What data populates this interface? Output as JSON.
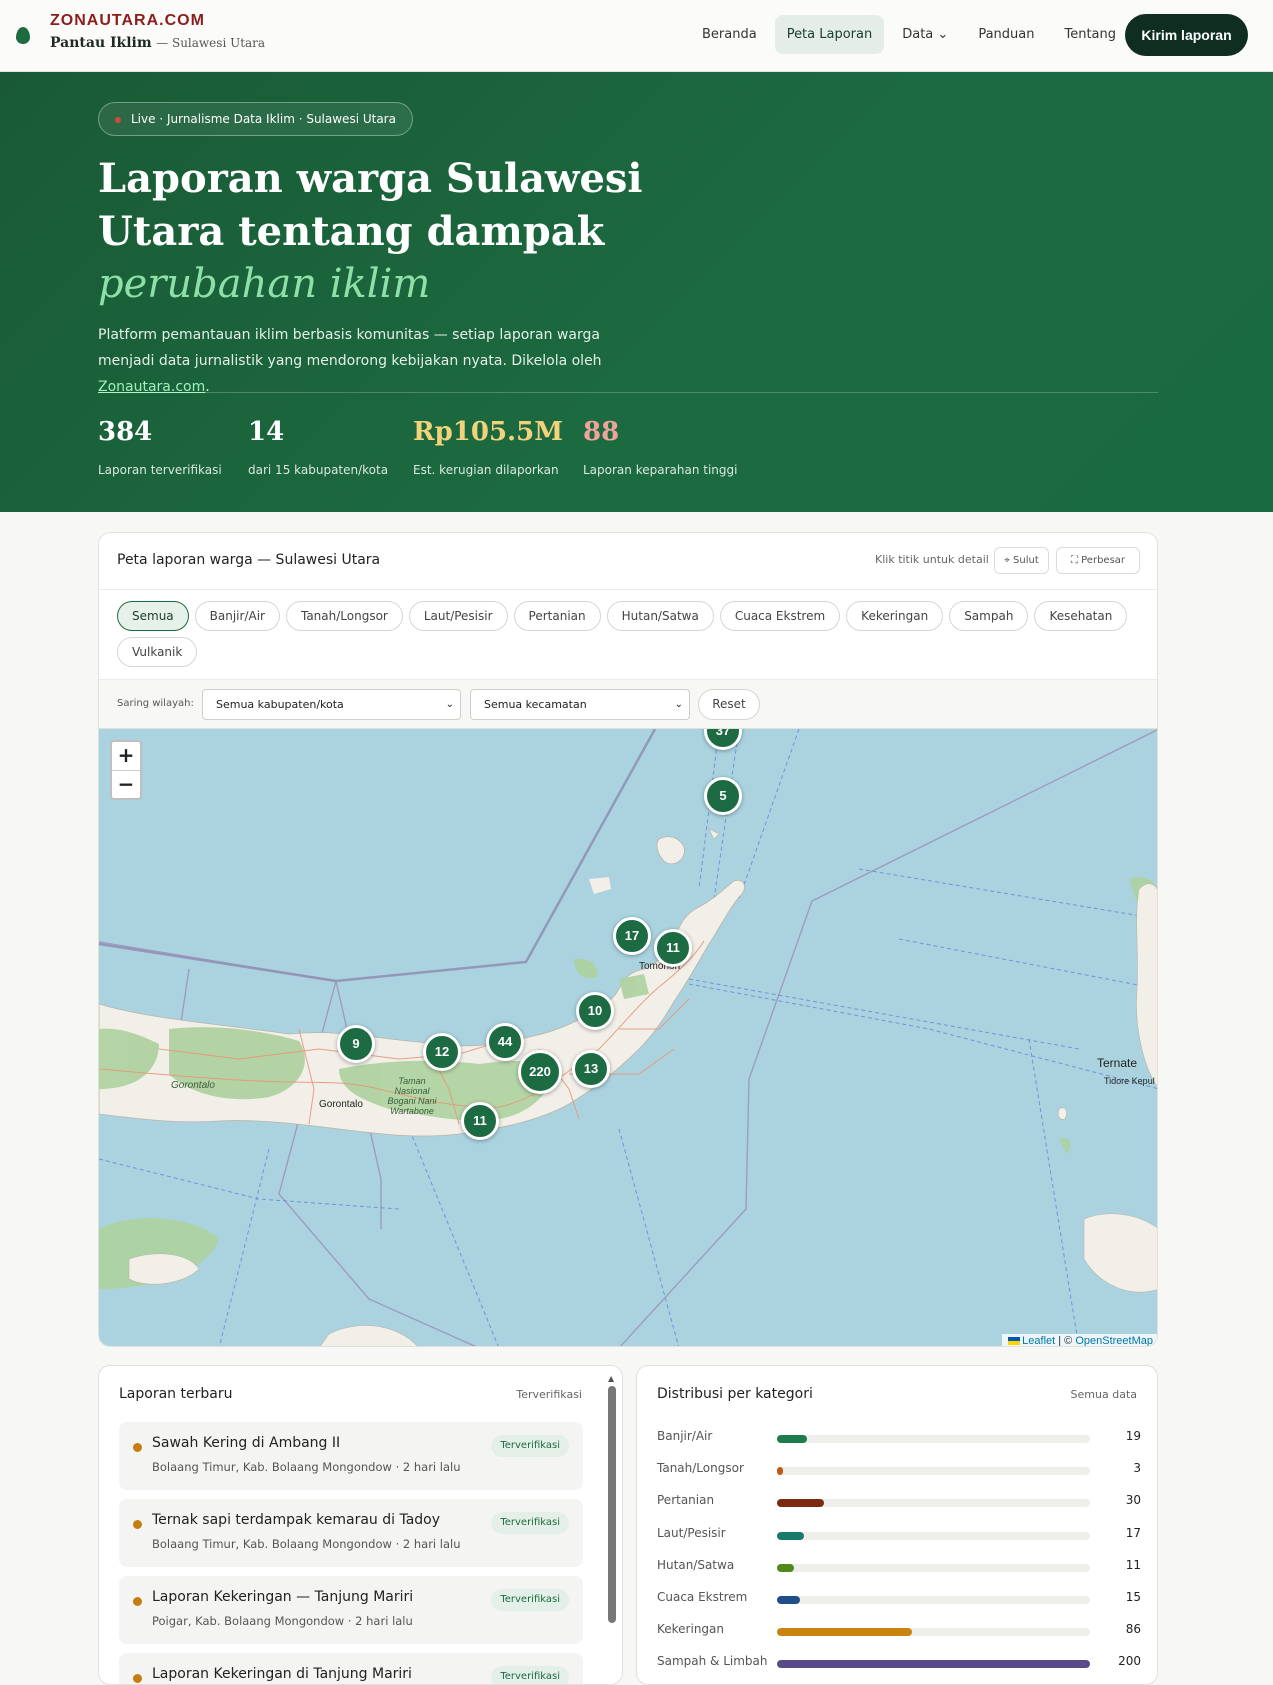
{
  "nav": {
    "brand_site": "ZONAUTARA.COM",
    "brand_title": "Pantau Iklim",
    "brand_region": "— Sulawesi Utara",
    "links": [
      "Beranda",
      "Peta Laporan",
      "Data ⌄",
      "Panduan",
      "Tentang"
    ],
    "active": "Peta Laporan",
    "cta": "Kirim laporan"
  },
  "hero": {
    "badge": "Live · Jurnalisme Data Iklim · Sulawesi Utara",
    "title_line": "Laporan warga Sulawesi Utara tentang dampak",
    "title_emph": "perubahan iklim",
    "lead": "Platform pemantauan iklim berbasis komunitas — setiap laporan warga menjadi data jurnalistik yang mendorong kebijakan nyata. Dikelola oleh",
    "lead_link": "Zonautara.com",
    "lead_end": ".",
    "stats": [
      {
        "value": "384",
        "label": "Laporan terverifikasi",
        "color": "#ffffff"
      },
      {
        "value": "14",
        "label": "dari 15 kabupaten/kota",
        "color": "#ffffff"
      },
      {
        "value": "Rp105.5M",
        "label": "Est. kerugian dilaporkan",
        "color": "#f2d27a"
      },
      {
        "value": "88",
        "label": "Laporan keparahan tinggi",
        "color": "#f0a39a"
      }
    ]
  },
  "map": {
    "title": "Peta laporan warga — Sulawesi Utara",
    "hint": "Klik titik untuk detail",
    "btn_sulut": "⌖ Sulut",
    "btn_expand": "⛶ Perbesar",
    "chips": [
      "Semua",
      "Banjir/Air",
      "Tanah/Longsor",
      "Laut/Pesisir",
      "Pertanian",
      "Hutan/Satwa",
      "Cuaca Ekstrem",
      "Kekeringan",
      "Sampah",
      "Kesehatan",
      "Vulkanik"
    ],
    "active_chip": "Semua",
    "filter_label": "Saring wilayah:",
    "select_kab": "Semua kabupaten/kota",
    "select_kec": "Semua kecamatan",
    "reset": "Reset",
    "zoom_in": "+",
    "zoom_out": "−",
    "clusters": [
      "37",
      "5",
      "17",
      "11",
      "10",
      "9",
      "12",
      "44",
      "220",
      "13",
      "11"
    ],
    "places": {
      "gorontalo_prov": "Gorontalo",
      "gorontalo_city": "Gorontalo",
      "tomohon": "Tomohon",
      "ternate": "Ternate",
      "tidore": "Tidore Kepul",
      "park": "Taman Nasional Bogani Nani Wartabone"
    },
    "attribution_leaflet": "Leaflet",
    "attribution_sep": " | © ",
    "attribution_osm": "OpenStreetMap"
  },
  "latest": {
    "title": "Laporan terbaru",
    "subtitle": "Terverifikasi",
    "items": [
      {
        "title": "Sawah Kering di Ambang II",
        "meta": "Bolaang Timur, Kab. Bolaang Mongondow · 2 hari lalu",
        "badge": "Terverifikasi"
      },
      {
        "title": "Ternak sapi terdampak kemarau di Tadoy",
        "meta": "Bolaang Timur, Kab. Bolaang Mongondow · 2 hari lalu",
        "badge": "Terverifikasi"
      },
      {
        "title": "Laporan Kekeringan — Tanjung Mariri",
        "meta": "Poigar, Kab. Bolaang Mongondow · 2 hari lalu",
        "badge": "Terverifikasi"
      },
      {
        "title": "Laporan Kekeringan di Tanjung Mariri",
        "meta": "",
        "badge": "Terverifikasi"
      }
    ]
  },
  "distribution": {
    "title": "Distribusi per kategori",
    "subtitle": "Semua data",
    "max": 200,
    "rows": [
      {
        "name": "Banjir/Air",
        "value": "19",
        "color": "#1f7a4d"
      },
      {
        "name": "Tanah/Longsor",
        "value": "3",
        "color": "#c05a18"
      },
      {
        "name": "Pertanian",
        "value": "30",
        "color": "#7a2b12"
      },
      {
        "name": "Laut/Pesisir",
        "value": "17",
        "color": "#187a6a"
      },
      {
        "name": "Hutan/Satwa",
        "value": "11",
        "color": "#4f8a1c"
      },
      {
        "name": "Cuaca Ekstrem",
        "value": "15",
        "color": "#1f4f8a"
      },
      {
        "name": "Kekeringan",
        "value": "86",
        "color": "#c98311"
      },
      {
        "name": "Sampah & Limbah",
        "value": "200",
        "color": "#5a4a8a"
      }
    ]
  }
}
